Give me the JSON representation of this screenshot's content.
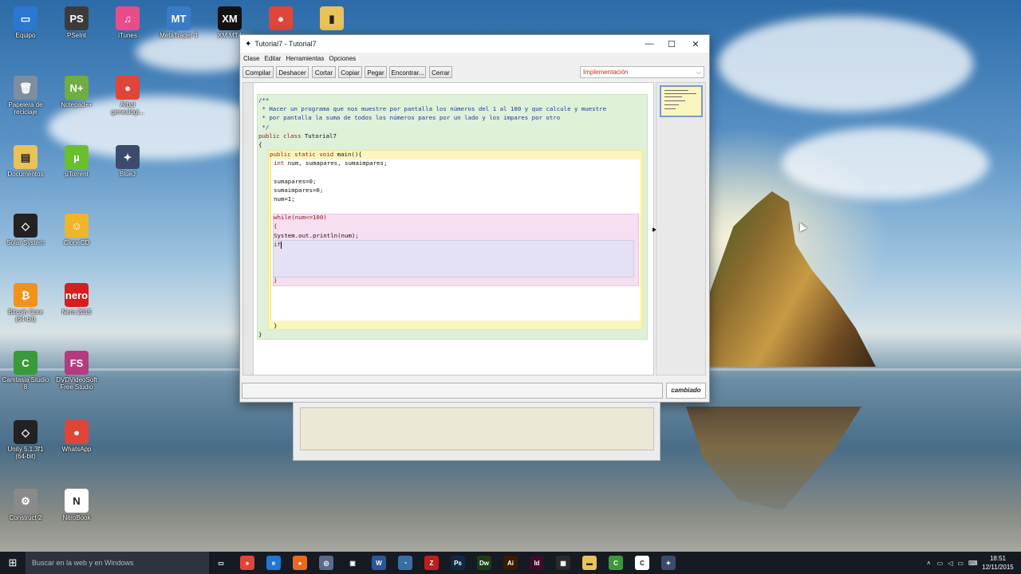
{
  "desktop": {
    "icons": [
      {
        "label": "Equipo",
        "icon": "computer-icon",
        "glyph": "▭",
        "color": "#2b78d0"
      },
      {
        "label": "PSeInt",
        "icon": "pseint-icon",
        "glyph": "PS",
        "color": "#3b3b3b"
      },
      {
        "label": "iTunes",
        "icon": "itunes-icon",
        "glyph": "♫",
        "color": "#e64d8c"
      },
      {
        "label": "MetaTrader 4",
        "icon": "metatrader-icon",
        "glyph": "MT",
        "color": "#3a7bc8"
      },
      {
        "label": "XM MT4",
        "icon": "xm-icon",
        "glyph": "XM",
        "color": "#111111"
      },
      {
        "label": "",
        "icon": "chrome-icon",
        "glyph": "●",
        "color": "#e0453a"
      },
      {
        "label": "",
        "icon": "folder-icon",
        "glyph": "▮",
        "color": "#e8c35a"
      },
      {
        "label": "Papelera de reciclaje",
        "icon": "recycle-bin-icon",
        "glyph": "🗑",
        "color": "#7f8da0"
      },
      {
        "label": "Notepad++",
        "icon": "notepad-plus-icon",
        "glyph": "N+",
        "color": "#6fae3f"
      },
      {
        "label": "Árbol genealógi...",
        "icon": "chrome-icon",
        "glyph": "●",
        "color": "#e0453a"
      },
      {
        "label": "Documentos",
        "icon": "documents-icon",
        "glyph": "▤",
        "color": "#e8c35a"
      },
      {
        "label": "µTorrent",
        "icon": "utorrent-icon",
        "glyph": "µ",
        "color": "#6abf2e"
      },
      {
        "label": "BlueJ",
        "icon": "bluej-icon",
        "glyph": "✦",
        "color": "#3c4b6b"
      },
      {
        "label": "Solar System",
        "icon": "unity-icon",
        "glyph": "◇",
        "color": "#222222"
      },
      {
        "label": "CloneCD",
        "icon": "clonecd-icon",
        "glyph": "☺",
        "color": "#f1b52a"
      },
      {
        "label": "Bitcoin Core (64-bit)",
        "icon": "bitcoin-icon",
        "glyph": "₿",
        "color": "#f3921b"
      },
      {
        "label": "Nero 2015",
        "icon": "nero-icon",
        "glyph": "nero",
        "color": "#d51f1f"
      },
      {
        "label": "Camtasia Studio 8",
        "icon": "camtasia-icon",
        "glyph": "C",
        "color": "#3a9a3a"
      },
      {
        "label": "DVDVideoSoft Free Studio",
        "icon": "freestudio-icon",
        "glyph": "FS",
        "color": "#b53a7f"
      },
      {
        "label": "Unity 5.1.3f1 (64-bit)",
        "icon": "unity-icon",
        "glyph": "◇",
        "color": "#222222"
      },
      {
        "label": "WhatsApp",
        "icon": "chrome-icon",
        "glyph": "●",
        "color": "#e0453a"
      },
      {
        "label": "Construct 2",
        "icon": "construct-icon",
        "glyph": "⚙",
        "color": "#8a8a8a"
      },
      {
        "label": "NitroBook",
        "icon": "nitrobook-icon",
        "glyph": "N",
        "color": "#ffffff"
      }
    ]
  },
  "window": {
    "title": "Tutorial7 - Tutorial7",
    "menu": [
      "Clase",
      "Editar",
      "Herramientas",
      "Opciones"
    ],
    "toolbar": {
      "buttons": [
        "Compilar",
        "Deshacer",
        "Cortar",
        "Copiar",
        "Pegar",
        "Encontrar...",
        "Cerrar"
      ],
      "view_select": "Implementación"
    },
    "status": "cambiado",
    "code": {
      "c1": "/**",
      "c2": " * Hacer un programa que nos muestre por pantalla los números del 1 al 100 y que calcule y muestre",
      "c3": " * por pantalla la suma de todos los números pares por un lado y los impares por otro",
      "c4": " */",
      "class_kw1": "public",
      "class_kw2": "class",
      "class_name": "Tutorial7",
      "open_class": "{",
      "m_kw1": "public",
      "m_kw2": "static",
      "m_kw3": "void",
      "m_name": "main(){",
      "decl_kw": "int",
      "decl_rest": " num, sumapares, sumaimpares;",
      "s1": "sumapares=0;",
      "s2": "sumaimpares=0;",
      "s3": "num=1;",
      "w1": "while(num<=100)",
      "w2": "{",
      "w3": "System.out.println(num);",
      "w4": "if",
      "w5": "}",
      "close_method": "}",
      "close_class": "}"
    }
  },
  "taskbar": {
    "search_placeholder": "Buscar en la web y en Windows",
    "apps": [
      {
        "icon": "task-view-icon",
        "glyph": "▭",
        "color": "#161a22"
      },
      {
        "icon": "chrome-icon",
        "glyph": "●",
        "color": "#e0453a"
      },
      {
        "icon": "edge-icon",
        "glyph": "e",
        "color": "#1f78d1"
      },
      {
        "icon": "firefox-icon",
        "glyph": "●",
        "color": "#e66a1f"
      },
      {
        "icon": "globe-icon",
        "glyph": "◎",
        "color": "#5a6a8a"
      },
      {
        "icon": "store-icon",
        "glyph": "▣",
        "color": "#161a22"
      },
      {
        "icon": "word-icon",
        "glyph": "W",
        "color": "#2b579a"
      },
      {
        "icon": "app-icon",
        "glyph": "◔",
        "color": "#3a6ea5"
      },
      {
        "icon": "filezilla-icon",
        "glyph": "Z",
        "color": "#bf1e1e"
      },
      {
        "icon": "photoshop-icon",
        "glyph": "Ps",
        "color": "#0c2a44"
      },
      {
        "icon": "dreamweaver-icon",
        "glyph": "Dw",
        "color": "#1b3d14"
      },
      {
        "icon": "illustrator-icon",
        "glyph": "Ai",
        "color": "#3a1a00"
      },
      {
        "icon": "indesign-icon",
        "glyph": "Id",
        "color": "#3f0b2a"
      },
      {
        "icon": "calculator-icon",
        "glyph": "▦",
        "color": "#2a2a2a"
      },
      {
        "icon": "file-explorer-icon",
        "glyph": "▬",
        "color": "#e8c35a"
      },
      {
        "icon": "camtasia-icon",
        "glyph": "C",
        "color": "#3a9a3a"
      },
      {
        "icon": "camtasia-recorder-icon",
        "glyph": "C",
        "color": "#ffffff"
      },
      {
        "icon": "bluej-icon",
        "glyph": "✦",
        "color": "#3c4b6b"
      }
    ],
    "clock_time": "18:51",
    "clock_date": "12/11/2015"
  }
}
